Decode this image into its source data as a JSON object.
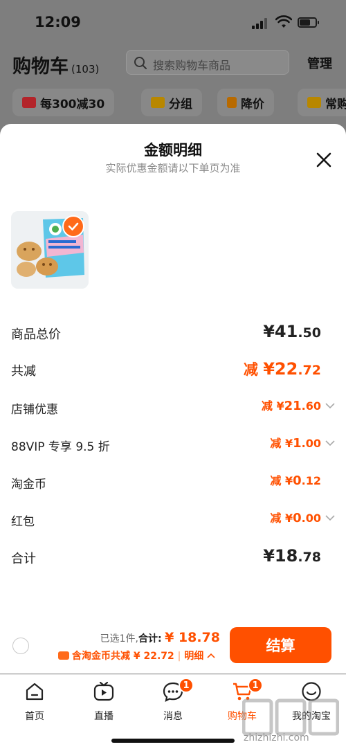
{
  "status_bar": {
    "time": "12:09"
  },
  "background": {
    "title": "购物车",
    "count": "(103)",
    "search_placeholder": "搜索购物车商品",
    "manage": "管理",
    "chips": [
      {
        "label": "每300减30",
        "icon": "coupon-icon"
      },
      {
        "label": "分组",
        "icon": "folder-icon"
      },
      {
        "label": "降价",
        "icon": "price-down-icon"
      },
      {
        "label": "常购",
        "icon": "cart-icon"
      }
    ]
  },
  "sheet": {
    "title": "金额明细",
    "subtitle": "实际优惠金额请以下单页为准",
    "rows": [
      {
        "label": "商品总价",
        "currency": "¥",
        "int": "41",
        "dec": ".50",
        "prefix": "",
        "expandable": false
      },
      {
        "label": "共减",
        "currency": "¥",
        "int": "22",
        "dec": ".72",
        "prefix": "减 ",
        "expandable": false
      },
      {
        "label": "店铺优惠",
        "currency": "¥",
        "int": "21",
        "dec": ".60",
        "prefix": "减 ",
        "expandable": true
      },
      {
        "label": "88VIP 专享 9.5 折",
        "currency": "¥",
        "int": "1",
        "dec": ".00",
        "prefix": "减 ",
        "expandable": true
      },
      {
        "label": "淘金币",
        "currency": "¥",
        "int": "0",
        "dec": ".12",
        "prefix": "减 ",
        "expandable": false
      },
      {
        "label": "红包",
        "currency": "¥",
        "int": "0",
        "dec": ".00",
        "prefix": "减 ",
        "expandable": true
      },
      {
        "label": "合计",
        "currency": "¥",
        "int": "18",
        "dec": ".78",
        "prefix": "",
        "expandable": false
      }
    ]
  },
  "checkout": {
    "selected": "已选1件,",
    "total_label": "合计:",
    "total_amount": "¥ 18.78",
    "coins_note": "含淘金币共减 ¥ 22.72",
    "separator": "|",
    "detail": "明细",
    "button": "结算"
  },
  "tabbar": {
    "items": [
      {
        "label": "首页",
        "icon": "home-icon",
        "badge": ""
      },
      {
        "label": "直播",
        "icon": "live-icon",
        "badge": ""
      },
      {
        "label": "消息",
        "icon": "message-icon",
        "badge": "1"
      },
      {
        "label": "购物车",
        "icon": "cart-icon",
        "badge": "1"
      },
      {
        "label": "我的淘宝",
        "icon": "profile-icon",
        "badge": ""
      }
    ]
  },
  "watermark": "zhizhizhi.com",
  "colors": {
    "accent": "#ff5000",
    "text": "#222222",
    "muted": "#8a8a8a"
  }
}
